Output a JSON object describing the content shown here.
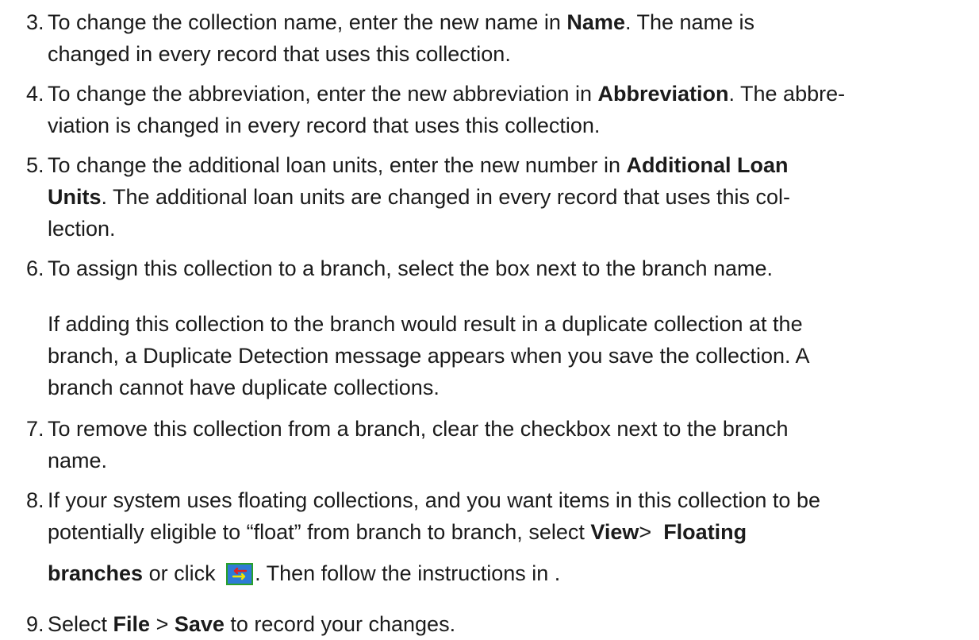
{
  "steps": [
    {
      "number": "3.",
      "lines": [
        [
          "To change the collection name, enter the new name in ",
          "Name",
          ". The name is"
        ],
        [
          "changed in every record that uses this collection."
        ]
      ]
    },
    {
      "number": "4.",
      "lines": [
        [
          "To change the abbreviation, enter the new abbreviation in ",
          "Abbreviation",
          ". The abbre-"
        ],
        [
          "viation is changed in every record that uses this collection."
        ]
      ]
    },
    {
      "number": "5.",
      "lines": [
        [
          "To change the additional loan units, enter the new number in ",
          "Additional Loan"
        ],
        [
          "",
          "Units",
          ". The additional loan units are changed in every record that uses this col-"
        ],
        [
          "lection."
        ]
      ]
    },
    {
      "number": "6.",
      "lines": [
        [
          "To assign this collection to a branch, select the box next to the branch name."
        ]
      ],
      "note_lines": [
        "If adding this collection to the branch would result in a duplicate collection at the",
        "branch, a Duplicate Detection message appears when you save the collection. A",
        "branch cannot have duplicate collections."
      ]
    },
    {
      "number": "7.",
      "lines": [
        [
          "To remove this collection from a branch, clear the checkbox next to the branch"
        ],
        [
          "name."
        ]
      ]
    },
    {
      "number": "8.",
      "lines": [
        [
          "If your system uses floating collections, and you want items in this collection to be"
        ],
        [
          "potentially eligible to “float” from branch to branch, select ",
          "View",
          ">  ",
          "Floating"
        ]
      ],
      "line3": {
        "bold": "branches",
        "before_icon": " or click ",
        "after_icon": ". Then follow the instructions in ."
      }
    },
    {
      "number": "9.",
      "lines": [
        [
          "Select ",
          "File",
          " > ",
          "Save",
          " to record your changes."
        ]
      ]
    }
  ],
  "icons": {
    "floating_branches_button": "floating-branches-icon"
  },
  "colors": {
    "text": "#1b1b1b",
    "icon_background": "#2d7bd6",
    "icon_border": "#2aa12a",
    "icon_arrow_red": "#e02020",
    "icon_arrow_yellow": "#f2e600"
  }
}
